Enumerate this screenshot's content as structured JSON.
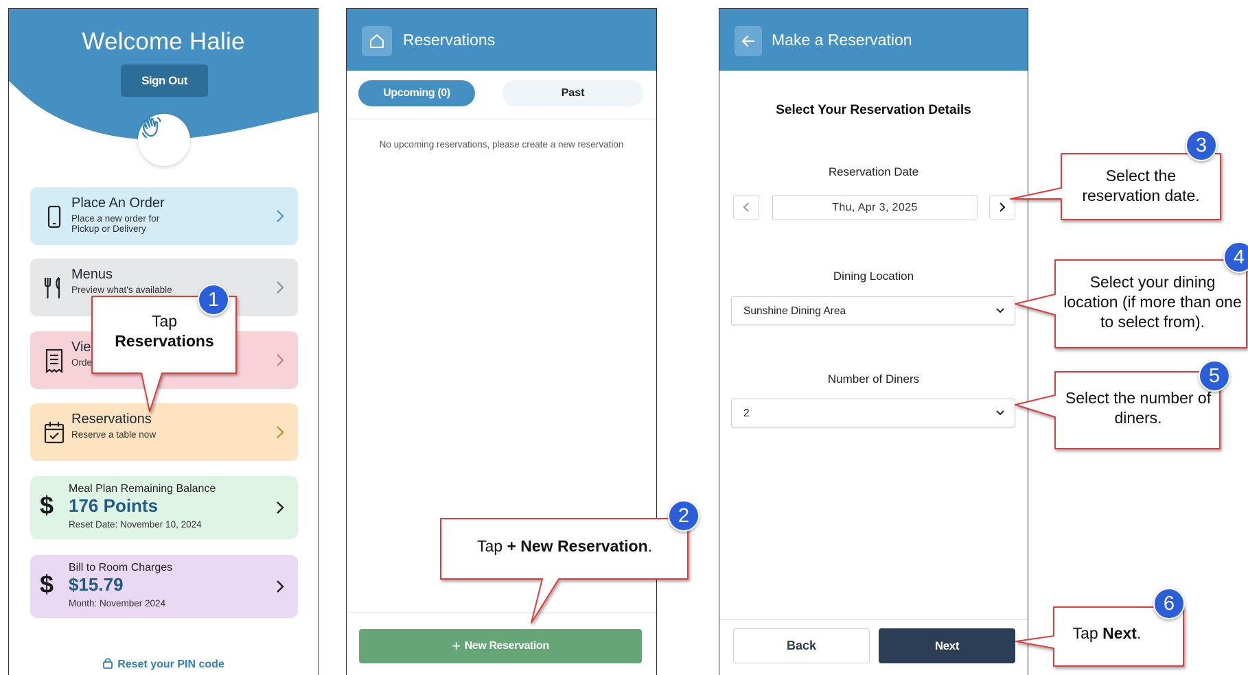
{
  "home": {
    "welcome": "Welcome Halie",
    "sign_out": "Sign Out",
    "cards": {
      "order": {
        "title": "Place An Order",
        "sub": "Place a new order for Pickup or Delivery"
      },
      "menus": {
        "title": "Menus",
        "sub": "Preview what's available"
      },
      "view": {
        "title": "Vie",
        "sub": "Orde"
      },
      "reservations": {
        "title": "Reservations",
        "sub": "Reserve a table now"
      },
      "meal": {
        "title": "Meal Plan Remaining Balance",
        "value": "176 Points",
        "sub": "Reset Date: November 10, 2024"
      },
      "bill": {
        "title": "Bill to Room Charges",
        "value": "$15.79",
        "sub": "Month: November 2024"
      }
    },
    "currency_symbol": "$",
    "pin_link": "Reset your PIN code"
  },
  "reservations": {
    "title": "Reservations",
    "tab_upcoming": "Upcoming (0)",
    "tab_past": "Past",
    "empty_text": "No upcoming reservations, please create a new reservation",
    "new_button": "New Reservation",
    "new_button_icon": "+"
  },
  "make": {
    "title": "Make a Reservation",
    "heading": "Select Your Reservation Details",
    "date_label": "Reservation Date",
    "date_value": "Thu, Apr 3, 2025",
    "location_label": "Dining Location",
    "location_value": "Sunshine Dining Area",
    "diners_label": "Number of Diners",
    "diners_value": "2",
    "back": "Back",
    "next": "Next"
  },
  "callouts": {
    "c1": {
      "badge": "1",
      "line1": "Tap",
      "line2": "Reservations"
    },
    "c2": {
      "badge": "2",
      "pre": "Tap ",
      "bold": "+ New Reservation",
      "post": "."
    },
    "c3": {
      "badge": "3",
      "text": "Select the reservation date."
    },
    "c4": {
      "badge": "4",
      "text": "Select your dining location (if more than one to select from)."
    },
    "c5": {
      "badge": "5",
      "text": "Select the number of diners."
    },
    "c6": {
      "badge": "6",
      "pre": "Tap ",
      "bold": "Next",
      "post": "."
    }
  },
  "colors": {
    "header_blue": "#4490c2",
    "badge_blue": "#2b5fd9",
    "callout_border": "#e53a3a",
    "next_navy": "#2c3e55",
    "new_green": "#66a676"
  }
}
